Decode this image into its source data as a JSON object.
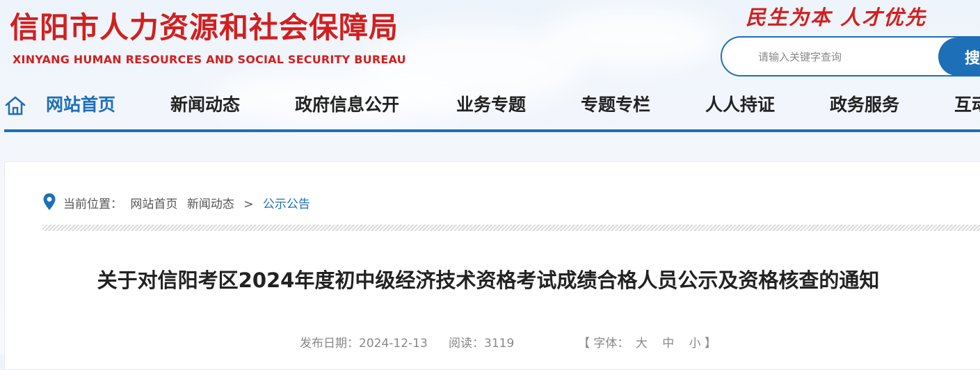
{
  "header": {
    "title_cn": "信阳市人力资源和社会保障局",
    "title_en": "XINYANG HUMAN RESOURCES AND SOCIAL SECURITY BUREAU",
    "slogan": "民生为本 人才优先",
    "brand_color": "#d21f1f",
    "accent_color": "#1d6fb8"
  },
  "search": {
    "placeholder": "请输入关键字查询",
    "button_label": "搜"
  },
  "nav": {
    "home_icon": "home-icon",
    "items": [
      {
        "label": "网站首页",
        "active": true
      },
      {
        "label": "新闻动态"
      },
      {
        "label": "政府信息公开"
      },
      {
        "label": "业务专题"
      },
      {
        "label": "专题专栏"
      },
      {
        "label": "人人持证"
      },
      {
        "label": "政务服务"
      },
      {
        "label": "互动"
      }
    ]
  },
  "breadcrumb": {
    "icon": "location-pin-icon",
    "prefix": "当前位置：",
    "home": "网站首页",
    "section": "新闻动态",
    "separator": ">",
    "current": "公示公告"
  },
  "article": {
    "title": "关于对信阳考区2024年度初中级经济技术资格考试成绩合格人员公示及资格核查的通知",
    "date_label": "发布日期：",
    "date": "2024-12-13",
    "views_label": "阅读：",
    "views": "3119",
    "font_bracket_open": "【",
    "font_label": "字体：",
    "font_large": "大",
    "font_medium": "中",
    "font_small": "小",
    "font_bracket_close": "】"
  }
}
